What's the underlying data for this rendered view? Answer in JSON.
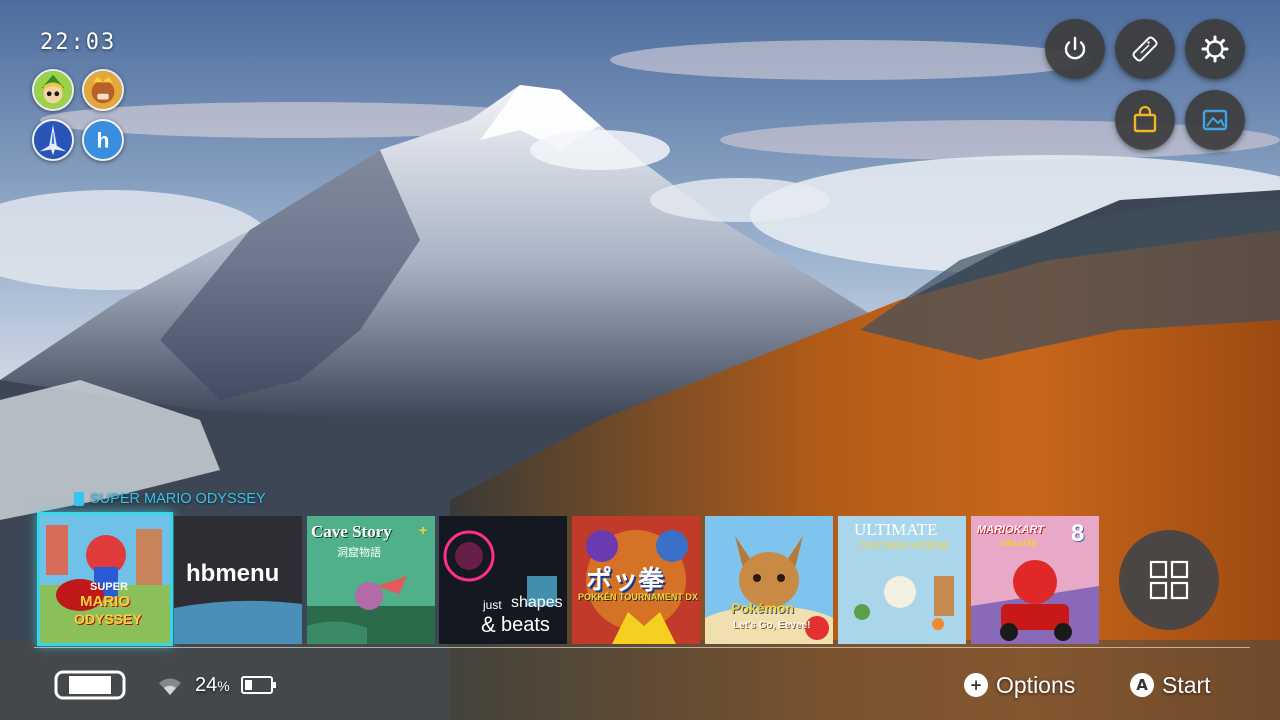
{
  "clock": "22:03",
  "users": [
    {
      "name": "link-avatar"
    },
    {
      "name": "king-avatar"
    },
    {
      "name": "ship-avatar"
    },
    {
      "name": "homebrew-avatar",
      "letter": "h"
    }
  ],
  "top_buttons": [
    {
      "icon": "power-icon"
    },
    {
      "icon": "controller-icon"
    },
    {
      "icon": "gear-icon"
    },
    {
      "icon": "shop-icon",
      "color": "#f2b524"
    },
    {
      "icon": "album-icon",
      "color": "#3fa3e8"
    }
  ],
  "selected_title": "SUPER MARIO ODYSSEY",
  "games": {
    "mario": {
      "line1": "SUPER",
      "line2": "MARIO",
      "line3": "ODYSSEY"
    },
    "hbmenu": {
      "title": "hbmenu"
    },
    "cavestory": {
      "title": "Cave Story",
      "plus": "+",
      "subtitle": "洞窟物語"
    },
    "jsb": {
      "line1a": "just",
      "line1b": "shapes",
      "line2a": "&",
      "line2b": "beats"
    },
    "pokken": {
      "title": "ポッ拳",
      "subtitle": "POKKÉN TOURNAMENT DX"
    },
    "eevee": {
      "title": "Pokémon",
      "subtitle": "Let's Go, Eevee!"
    },
    "uch": {
      "line1": "ULTIMATE",
      "line2": "CHICKEN HORSE"
    },
    "mk8": {
      "line1": "MARIOKART",
      "line2": "DELUXE",
      "badge": "8"
    }
  },
  "status": {
    "battery": "24",
    "battery_unit": "%"
  },
  "hints": {
    "options_glyph": "+",
    "options_label": "Options",
    "start_glyph": "A",
    "start_label": "Start"
  },
  "colors": {
    "accent": "#36d6e8",
    "title": "#34c6f0"
  }
}
